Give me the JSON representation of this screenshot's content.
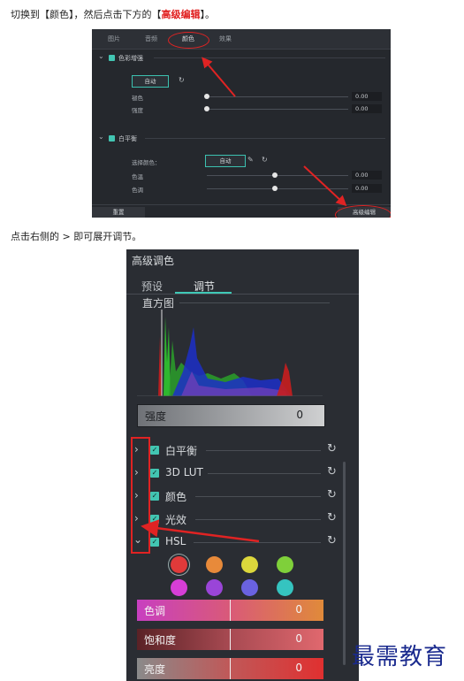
{
  "captions": {
    "step1_prefix": "切换到【颜色】，然后点击下方的【",
    "step1_highlight": "高级编辑",
    "step1_suffix": "】。",
    "step2": "点击右侧的 > 即可展开调节。"
  },
  "shot1": {
    "tabs": [
      "图片",
      "音频",
      "颜色",
      "效果"
    ],
    "active_tab": "颜色",
    "color_enhance": {
      "label": "色彩增强",
      "auto_button": "自动",
      "rows": [
        {
          "label": "褪色",
          "value": "0.00"
        },
        {
          "label": "强度",
          "value": "0.00"
        }
      ]
    },
    "white_balance": {
      "label": "白平衡",
      "select_color_label": "选择颜色：",
      "auto_button": "自动",
      "rows": [
        {
          "label": "色温",
          "value": "0.00"
        },
        {
          "label": "色调",
          "value": "0.00"
        }
      ]
    },
    "reset_button": "重置",
    "advanced_button": "高级编辑"
  },
  "shot2": {
    "title": "高级调色",
    "tabs": [
      "预设",
      "调节"
    ],
    "active_tab": "调节",
    "histogram_title": "直方图",
    "strength": {
      "label": "强度",
      "value": "0"
    },
    "sections": [
      {
        "label": "白平衡",
        "expanded": false
      },
      {
        "label": "3D LUT",
        "expanded": false
      },
      {
        "label": "颜色",
        "expanded": false
      },
      {
        "label": "光效",
        "expanded": false
      },
      {
        "label": "HSL",
        "expanded": true
      }
    ],
    "hsl_swatches": [
      "#e03a3a",
      "#e88a3a",
      "#dcd73c",
      "#7fd03a",
      "#d63ed6",
      "#9a45d8",
      "#6a62e0",
      "#35c4c0"
    ],
    "sliders": [
      {
        "label": "色调",
        "value": "0"
      },
      {
        "label": "饱和度",
        "value": "0"
      },
      {
        "label": "亮度",
        "value": "0"
      }
    ]
  },
  "watermark": "最需教育",
  "colors": {
    "accent": "#42c5b2",
    "annotation_red": "#e02323",
    "panel_bg": "#2a2d33"
  }
}
